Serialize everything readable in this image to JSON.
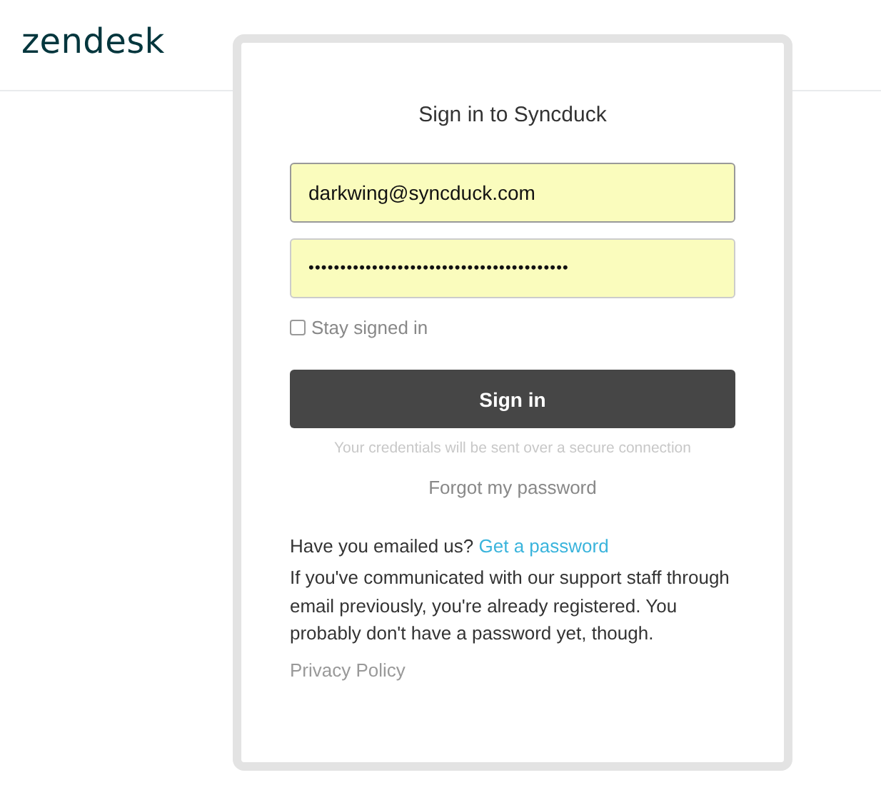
{
  "header": {
    "logo": "zendesk"
  },
  "dialog": {
    "title": "Sign in to Syncduck",
    "email": {
      "value": "darkwing@syncduck.com"
    },
    "password": {
      "value": "•••••••••••••••••••••••••••••••••••••••••"
    },
    "stay_signed_in": {
      "label": "Stay signed in",
      "checked": false
    },
    "submit": "Sign in",
    "note": "Your credentials will be sent over a secure connection",
    "forgot": "Forgot my password",
    "emailed": {
      "prompt": "Have you emailed us?",
      "link": "Get a password"
    },
    "info": "If you've communicated with our support staff through email previously, you're already registered. You probably don't have a password yet, though.",
    "privacy": "Privacy Policy"
  }
}
